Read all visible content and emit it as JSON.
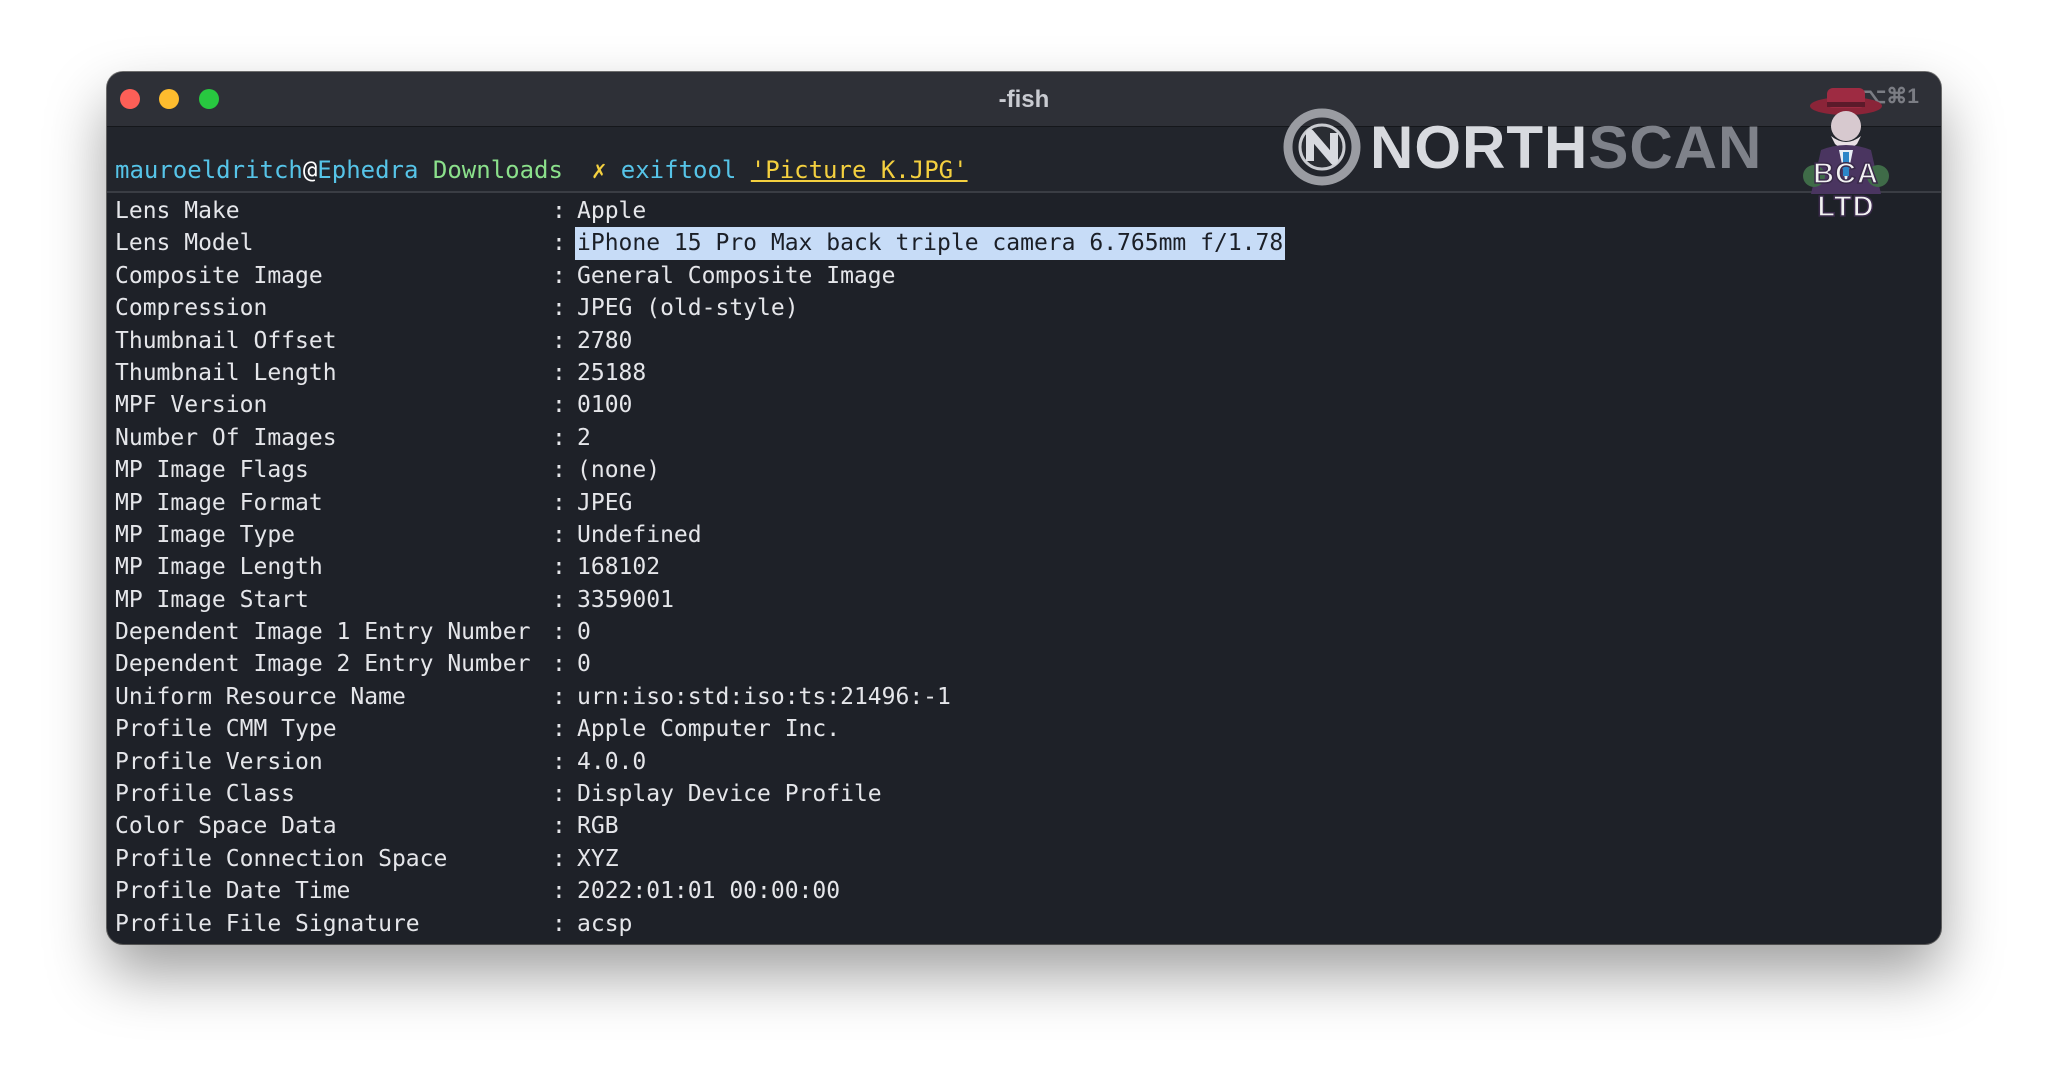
{
  "window": {
    "title": "-fish",
    "shortcut": "⌥⌘1"
  },
  "prompt": {
    "user": "mauroeldritch",
    "at": "@",
    "host": "Ephedra",
    "directory": "Downloads",
    "symbol": "✗",
    "command": "exiftool",
    "argument": "'Picture K.JPG'"
  },
  "watermark": {
    "logo_north": "NORTH",
    "logo_scan": "SCAN",
    "badge_text": "BCA LTD"
  },
  "output": {
    "separator": ":",
    "rows": [
      {
        "key": "Lens Make",
        "value": "Apple"
      },
      {
        "key": "Lens Model",
        "value": "iPhone 15 Pro Max back triple camera 6.765mm f/1.78"
      },
      {
        "key": "Composite Image",
        "value": "General Composite Image"
      },
      {
        "key": "Compression",
        "value": "JPEG (old-style)"
      },
      {
        "key": "Thumbnail Offset",
        "value": "2780"
      },
      {
        "key": "Thumbnail Length",
        "value": "25188"
      },
      {
        "key": "MPF Version",
        "value": "0100"
      },
      {
        "key": "Number Of Images",
        "value": "2"
      },
      {
        "key": "MP Image Flags",
        "value": "(none)"
      },
      {
        "key": "MP Image Format",
        "value": "JPEG"
      },
      {
        "key": "MP Image Type",
        "value": "Undefined"
      },
      {
        "key": "MP Image Length",
        "value": "168102"
      },
      {
        "key": "MP Image Start",
        "value": "3359001"
      },
      {
        "key": "Dependent Image 1 Entry Number",
        "value": "0"
      },
      {
        "key": "Dependent Image 2 Entry Number",
        "value": "0"
      },
      {
        "key": "Uniform Resource Name",
        "value": "urn:iso:std:iso:ts:21496:-1"
      },
      {
        "key": "Profile CMM Type",
        "value": "Apple Computer Inc."
      },
      {
        "key": "Profile Version",
        "value": "4.0.0"
      },
      {
        "key": "Profile Class",
        "value": "Display Device Profile"
      },
      {
        "key": "Color Space Data",
        "value": "RGB"
      },
      {
        "key": "Profile Connection Space",
        "value": "XYZ"
      },
      {
        "key": "Profile Date Time",
        "value": "2022:01:01 00:00:00"
      },
      {
        "key": "Profile File Signature",
        "value": "acsp"
      }
    ],
    "selected_row": "Lens Model"
  }
}
